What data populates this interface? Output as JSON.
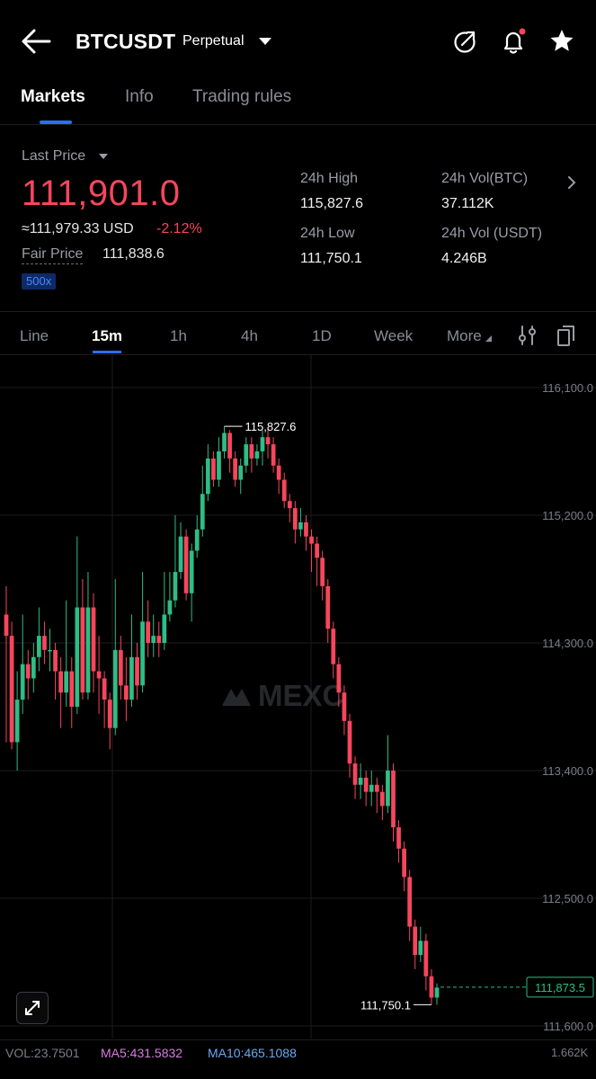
{
  "header": {
    "symbol": "BTCUSDT",
    "contract_type": "Perpetual",
    "icons": [
      "back-arrow-icon",
      "share-icon",
      "bell-icon",
      "star-icon"
    ]
  },
  "tabs": [
    {
      "label": "Markets",
      "active": true
    },
    {
      "label": "Info",
      "active": false
    },
    {
      "label": "Trading rules",
      "active": false
    }
  ],
  "stats": {
    "last_price_label": "Last Price",
    "last_price": "111,901.0",
    "usd_value": "≈111,979.33 USD",
    "change_pct": "-2.12%",
    "fair_price_label": "Fair Price",
    "fair_price": "111,838.6",
    "leverage": "500x",
    "high_label": "24h High",
    "high": "115,827.6",
    "low_label": "24h Low",
    "low": "111,750.1",
    "vol_btc_label": "24h Vol(BTC)",
    "vol_btc": "37.112K",
    "vol_usdt_label": "24h Vol (USDT)",
    "vol_usdt": "4.246B"
  },
  "timeframes": [
    {
      "label": "Line",
      "active": false
    },
    {
      "label": "15m",
      "active": true
    },
    {
      "label": "1h",
      "active": false
    },
    {
      "label": "4h",
      "active": false
    },
    {
      "label": "1D",
      "active": false
    },
    {
      "label": "Week",
      "active": false
    },
    {
      "label": "More",
      "active": false
    }
  ],
  "chart_data": {
    "type": "candlestick",
    "interval": "15m",
    "y_ticks": [
      "116,100.0",
      "115,200.0",
      "114,300.0",
      "113,400.0",
      "112,500.0",
      "111,600.0"
    ],
    "ylim": [
      111600,
      116100
    ],
    "high_marker": "115,827.6",
    "low_marker": "111,750.1",
    "current_price": "111,873.5",
    "volume_axis_label": "1.662K",
    "watermark": "MEXC",
    "colors": {
      "up": "#2ebd85",
      "down": "#f6465d",
      "grid": "#1c1c20"
    },
    "candles": [
      [
        114500,
        114350,
        114700,
        113600
      ],
      [
        114350,
        113600,
        114450,
        113550
      ],
      [
        113600,
        113900,
        114100,
        113400
      ],
      [
        113900,
        114150,
        114500,
        113800
      ],
      [
        114150,
        114050,
        114250,
        113900
      ],
      [
        114050,
        114200,
        114300,
        113950
      ],
      [
        114200,
        114350,
        114550,
        114100
      ],
      [
        114350,
        114250,
        114450,
        114150
      ],
      [
        114250,
        114250,
        114400,
        114100
      ],
      [
        114250,
        114100,
        114300,
        113900
      ],
      [
        114100,
        113950,
        114200,
        113700
      ],
      [
        113950,
        114100,
        114600,
        113850
      ],
      [
        114100,
        113850,
        114200,
        113700
      ],
      [
        113850,
        114550,
        115050,
        113800
      ],
      [
        114550,
        113950,
        114750,
        113900
      ],
      [
        113950,
        114550,
        114800,
        113900
      ],
      [
        114550,
        114100,
        114650,
        113950
      ],
      [
        114100,
        114050,
        114350,
        113800
      ],
      [
        114050,
        113900,
        114100,
        113700
      ],
      [
        113900,
        113700,
        113950,
        113550
      ],
      [
        113700,
        114250,
        114750,
        113650
      ],
      [
        114250,
        114000,
        114350,
        113900
      ],
      [
        114000,
        113900,
        114200,
        113750
      ],
      [
        113900,
        114200,
        114500,
        113850
      ],
      [
        114200,
        114000,
        114300,
        113900
      ],
      [
        114000,
        114450,
        114800,
        113950
      ],
      [
        114450,
        114300,
        114600,
        114200
      ],
      [
        114300,
        114350,
        114500,
        114200
      ],
      [
        114350,
        114300,
        114450,
        114200
      ],
      [
        114300,
        114500,
        114800,
        114250
      ],
      [
        114500,
        114600,
        114800,
        114450
      ],
      [
        114600,
        114800,
        115200,
        114550
      ],
      [
        114800,
        115050,
        115150,
        114750
      ],
      [
        115050,
        114650,
        115100,
        114600
      ],
      [
        114650,
        114950,
        115000,
        114450
      ],
      [
        114950,
        115100,
        115200,
        114900
      ],
      [
        115100,
        115350,
        115550,
        115050
      ],
      [
        115350,
        115600,
        115700,
        115300
      ],
      [
        115600,
        115450,
        115650,
        115400
      ],
      [
        115450,
        115650,
        115750,
        115400
      ],
      [
        115650,
        115780,
        115827,
        115600
      ],
      [
        115780,
        115600,
        115800,
        115500
      ],
      [
        115600,
        115450,
        115650,
        115400
      ],
      [
        115450,
        115550,
        115600,
        115350
      ],
      [
        115550,
        115700,
        115750,
        115500
      ],
      [
        115700,
        115600,
        115750,
        115500
      ],
      [
        115600,
        115650,
        115700,
        115550
      ],
      [
        115650,
        115750,
        115800,
        115550
      ],
      [
        115750,
        115700,
        115820,
        115600
      ],
      [
        115700,
        115550,
        115750,
        115500
      ],
      [
        115550,
        115450,
        115600,
        115350
      ],
      [
        115450,
        115300,
        115500,
        115250
      ],
      [
        115300,
        115250,
        115350,
        115150
      ],
      [
        115250,
        115100,
        115300,
        115000
      ],
      [
        115100,
        115150,
        115250,
        115050
      ],
      [
        115150,
        115050,
        115200,
        114950
      ],
      [
        115050,
        115000,
        115100,
        114800
      ],
      [
        115000,
        114900,
        115050,
        114700
      ],
      [
        114900,
        114700,
        114950,
        114600
      ],
      [
        114700,
        114400,
        114750,
        114300
      ],
      [
        114400,
        114150,
        114450,
        114050
      ],
      [
        114150,
        113950,
        114200,
        113850
      ],
      [
        113950,
        113750,
        114000,
        113650
      ],
      [
        113750,
        113450,
        113800,
        113350
      ],
      [
        113450,
        113300,
        113500,
        113200
      ],
      [
        113300,
        113350,
        113450,
        113200
      ],
      [
        113350,
        113250,
        113400,
        113150
      ],
      [
        113250,
        113300,
        113400,
        113150
      ],
      [
        113300,
        113250,
        113350,
        113100
      ],
      [
        113250,
        113150,
        113300,
        113050
      ],
      [
        113150,
        113400,
        113650,
        113100
      ],
      [
        113400,
        113000,
        113450,
        112900
      ],
      [
        113000,
        112850,
        113050,
        112750
      ],
      [
        112850,
        112650,
        112900,
        112550
      ],
      [
        112650,
        112300,
        112700,
        112200
      ],
      [
        112300,
        112100,
        112350,
        112000
      ],
      [
        112100,
        112200,
        112300,
        112050
      ],
      [
        112200,
        111950,
        112250,
        111850
      ],
      [
        111950,
        111800,
        112000,
        111750
      ],
      [
        111800,
        111870,
        111900,
        111750
      ]
    ]
  },
  "volume": {
    "vol": "VOL:23.7501",
    "ma5": "MA5:431.5832",
    "ma10": "MA10:465.1088"
  }
}
